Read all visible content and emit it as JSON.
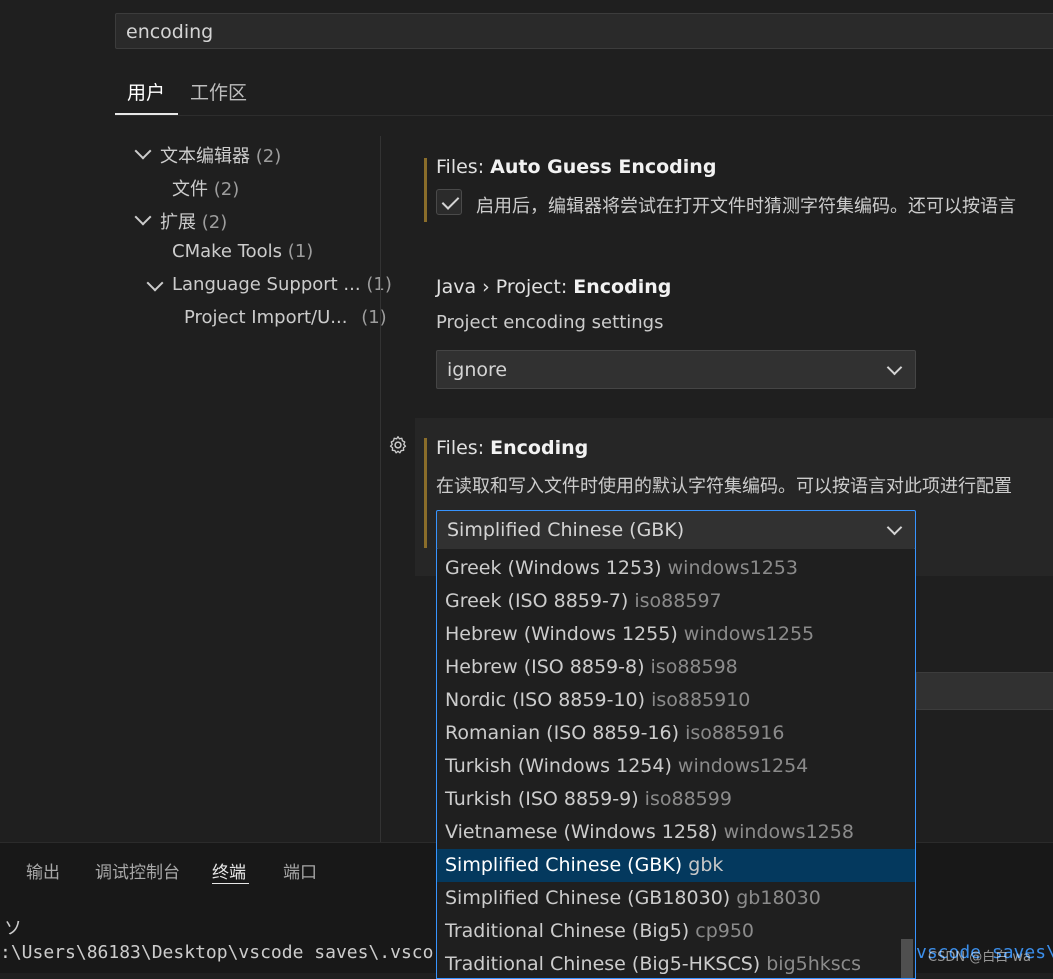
{
  "search": {
    "value": "encoding"
  },
  "tabs": [
    {
      "label": "用户"
    },
    {
      "label": "工作区"
    }
  ],
  "toc": [
    {
      "label": "文本编辑器",
      "count": "(2)"
    },
    {
      "label": "文件",
      "count": "(2)"
    },
    {
      "label": "扩展",
      "count": "(2)"
    },
    {
      "label": "CMake Tools",
      "count": "(1)"
    },
    {
      "label": "Language Support ...",
      "count": "(1)"
    },
    {
      "label": "Project Import/U...",
      "count": "(1)"
    }
  ],
  "settings": {
    "auto_guess": {
      "category": "Files: ",
      "name": "Auto Guess Encoding",
      "desc": "启用后，编辑器将尝试在打开文件时猜测字符集编码。还可以按语言"
    },
    "java_project": {
      "category": "Java › Project: ",
      "name": "Encoding",
      "desc": "Project encoding settings",
      "value": "ignore"
    },
    "files_encoding": {
      "category": "Files: ",
      "name": "Encoding",
      "desc": "在读取和写入文件时使用的默认字符集编码。可以按语言对此项进行配置",
      "value": "Simplified Chinese (GBK)"
    }
  },
  "dropdown": {
    "options": [
      {
        "label": "Greek (Windows 1253)",
        "alias": "windows1253"
      },
      {
        "label": "Greek (ISO 8859-7)",
        "alias": "iso88597"
      },
      {
        "label": "Hebrew (Windows 1255)",
        "alias": "windows1255"
      },
      {
        "label": "Hebrew (ISO 8859-8)",
        "alias": "iso88598"
      },
      {
        "label": "Nordic (ISO 8859-10)",
        "alias": "iso885910"
      },
      {
        "label": "Romanian (ISO 8859-16)",
        "alias": "iso885916"
      },
      {
        "label": "Turkish (Windows 1254)",
        "alias": "windows1254"
      },
      {
        "label": "Turkish (ISO 8859-9)",
        "alias": "iso88599"
      },
      {
        "label": "Vietnamese (Windows 1258)",
        "alias": "windows1258"
      },
      {
        "label": "Simplified Chinese (GBK)",
        "alias": "gbk"
      },
      {
        "label": "Simplified Chinese (GB18030)",
        "alias": "gb18030"
      },
      {
        "label": "Traditional Chinese (Big5)",
        "alias": "cp950"
      },
      {
        "label": "Traditional Chinese (Big5-HKSCS)",
        "alias": "big5hkscs"
      }
    ],
    "selected_index": 9
  },
  "panel": {
    "tabs": [
      "输出",
      "调试控制台",
      "终端",
      "端口"
    ],
    "active_tab": "终端",
    "terminal_lines": [
      "ソ",
      ":\\Users\\86183\\Desktop\\vscode saves\\.vsco"
    ],
    "terminal_right": "vscode saves\\"
  },
  "watermark": "CSDN @白白 wa"
}
